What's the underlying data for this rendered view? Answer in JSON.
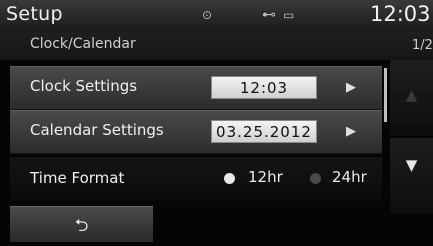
{
  "header": {
    "title": "Setup",
    "disc_icon": "⊙",
    "usb_icon": "⊷",
    "battery_icon": "▭",
    "clock": "12:03"
  },
  "breadcrumb": "Clock/Calendar",
  "page_indicator": "1/2",
  "clock_settings": {
    "label": "Clock Settings",
    "value": "12:03",
    "arrow": "▶"
  },
  "calendar_settings": {
    "label": "Calendar Settings",
    "value": "03.25.2012",
    "arrow": "▶"
  },
  "time_format": {
    "label": "Time Format",
    "option_12": "12hr",
    "option_24": "24hr",
    "selected": "12hr"
  },
  "scroll": {
    "up_glyph": "▲",
    "down_glyph": "▼"
  },
  "back_glyph": "⮌",
  "colors": {
    "radio_selected": "#e8e8e8",
    "radio_unselected": "#4a4a4a",
    "scroll_up_disabled": "#3a3a3a",
    "scroll_down_enabled": "#e6e6e6"
  }
}
